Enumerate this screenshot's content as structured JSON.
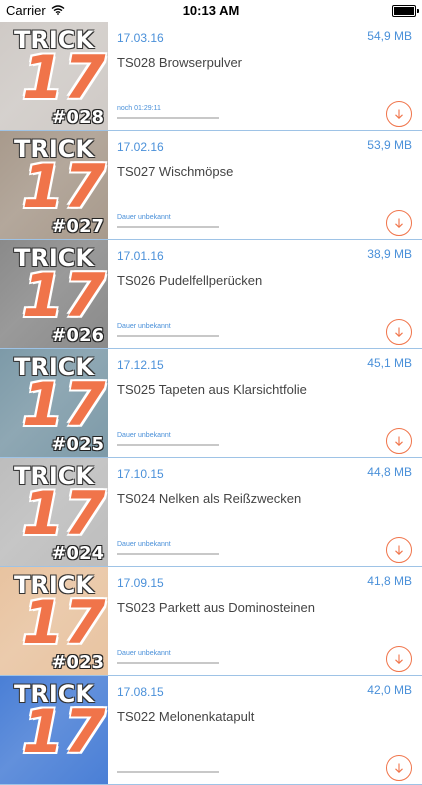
{
  "status_bar": {
    "carrier": "Carrier",
    "time": "10:13 AM"
  },
  "brand": {
    "logo_word": "TRICK",
    "logo_number": "17"
  },
  "colors": {
    "accent_orange": "#f0744a",
    "accent_blue": "#4a90d9",
    "divider": "#9ec3e6"
  },
  "episodes": [
    {
      "ep": "#028",
      "date": "17.03.16",
      "size": "54,9 MB",
      "title": "TS028 Browserpulver",
      "duration": "noch 01:29:11",
      "progress": 0,
      "thumb_color": "#cfcac6"
    },
    {
      "ep": "#027",
      "date": "17.02.16",
      "size": "53,9 MB",
      "title": "TS027 Wischmöpse",
      "duration": "Dauer unbekannt",
      "progress": 0,
      "thumb_color": "#a89a8c"
    },
    {
      "ep": "#026",
      "date": "17.01.16",
      "size": "38,9 MB",
      "title": "TS026 Pudelfellperücken",
      "duration": "Dauer unbekannt",
      "progress": 0,
      "thumb_color": "#8a8a8a"
    },
    {
      "ep": "#025",
      "date": "17.12.15",
      "size": "45,1 MB",
      "title": "TS025 Tapeten aus Klarsichtfolie",
      "duration": "Dauer unbekannt",
      "progress": 0,
      "thumb_color": "#7d9aa8"
    },
    {
      "ep": "#024",
      "date": "17.10.15",
      "size": "44,8 MB",
      "title": "TS024 Nelken als Reißzwecken",
      "duration": "Dauer unbekannt",
      "progress": 0,
      "thumb_color": "#bdbdbd"
    },
    {
      "ep": "#023",
      "date": "17.09.15",
      "size": "41,8 MB",
      "title": "TS023 Parkett aus Dominosteinen",
      "duration": "Dauer unbekannt",
      "progress": 0,
      "thumb_color": "#e8c3a0"
    },
    {
      "ep": "",
      "date": "17.08.15",
      "size": "42,0 MB",
      "title": "TS022 Melonenkatapult",
      "duration": "",
      "progress": 0,
      "thumb_color": "#4a7fd6"
    }
  ]
}
